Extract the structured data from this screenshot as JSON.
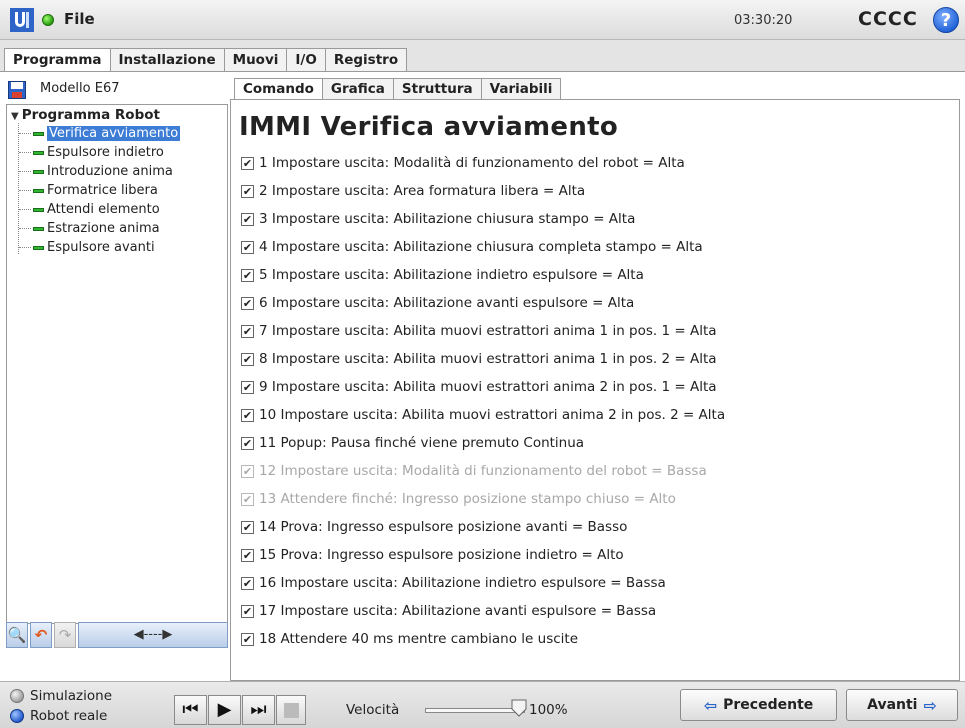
{
  "titlebar": {
    "file_label": "File",
    "clock": "03:30:20",
    "robot_name": "CCCC",
    "help_glyph": "?",
    "logo_icon": "ur-logo-icon",
    "status_icon": "green-status-dot-icon"
  },
  "main_tabs": [
    {
      "label": "Programma",
      "active": true
    },
    {
      "label": "Installazione",
      "active": false
    },
    {
      "label": "Muovi",
      "active": false
    },
    {
      "label": "I/O",
      "active": false
    },
    {
      "label": "Registro",
      "active": false
    }
  ],
  "program": {
    "model_name": "Modello E67"
  },
  "tree": {
    "root_label": "Programma Robot",
    "items": [
      {
        "label": "Verifica avviamento",
        "selected": true
      },
      {
        "label": "Espulsore indietro",
        "selected": false
      },
      {
        "label": "Introduzione anima",
        "selected": false
      },
      {
        "label": "Formatrice libera",
        "selected": false
      },
      {
        "label": "Attendi elemento",
        "selected": false
      },
      {
        "label": "Estrazione anima",
        "selected": false
      },
      {
        "label": "Espulsore avanti",
        "selected": false
      }
    ]
  },
  "tree_toolbar": {
    "search_glyph": "🔍",
    "undo_glyph": "↶",
    "redo_glyph": "↷",
    "move_glyph": "◀----▶"
  },
  "sub_tabs": [
    {
      "label": "Comando",
      "active": true
    },
    {
      "label": "Grafica",
      "active": false
    },
    {
      "label": "Struttura",
      "active": false
    },
    {
      "label": "Variabili",
      "active": false
    }
  ],
  "panel": {
    "title": "IMMI Verifica avviamento",
    "commands": [
      {
        "text": "1 Impostare uscita: Modalità di funzionamento del robot = Alta",
        "checked": true,
        "enabled": true
      },
      {
        "text": "2 Impostare uscita: Area formatura libera = Alta",
        "checked": true,
        "enabled": true
      },
      {
        "text": "3 Impostare uscita: Abilitazione chiusura stampo = Alta",
        "checked": true,
        "enabled": true
      },
      {
        "text": "4 Impostare uscita: Abilitazione chiusura completa stampo = Alta",
        "checked": true,
        "enabled": true
      },
      {
        "text": "5 Impostare uscita: Abilitazione indietro espulsore = Alta",
        "checked": true,
        "enabled": true
      },
      {
        "text": "6 Impostare uscita: Abilitazione avanti espulsore = Alta",
        "checked": true,
        "enabled": true
      },
      {
        "text": "7 Impostare uscita: Abilita muovi estrattori anima 1 in pos. 1 = Alta",
        "checked": true,
        "enabled": true
      },
      {
        "text": "8 Impostare uscita: Abilita muovi estrattori anima 1 in pos. 2 = Alta",
        "checked": true,
        "enabled": true
      },
      {
        "text": "9 Impostare uscita: Abilita muovi estrattori anima 2 in pos. 1 = Alta",
        "checked": true,
        "enabled": true
      },
      {
        "text": "10 Impostare uscita: Abilita muovi estrattori anima 2 in pos. 2 = Alta",
        "checked": true,
        "enabled": true
      },
      {
        "text": "11 Popup: Pausa finché viene premuto Continua",
        "checked": true,
        "enabled": true
      },
      {
        "text": "12 Impostare uscita: Modalità di funzionamento del robot = Bassa",
        "checked": true,
        "enabled": false
      },
      {
        "text": "13 Attendere finché: Ingresso posizione stampo chiuso = Alto",
        "checked": true,
        "enabled": false
      },
      {
        "text": "14 Prova: Ingresso espulsore posizione avanti = Basso",
        "checked": true,
        "enabled": true
      },
      {
        "text": "15 Prova: Ingresso espulsore posizione indietro = Alto",
        "checked": true,
        "enabled": true
      },
      {
        "text": "16 Impostare uscita: Abilitazione indietro espulsore = Bassa",
        "checked": true,
        "enabled": true
      },
      {
        "text": "17 Impostare uscita: Abilitazione avanti espulsore = Bassa",
        "checked": true,
        "enabled": true
      },
      {
        "text": "18 Attendere 40 ms mentre cambiano le uscite",
        "checked": true,
        "enabled": true
      }
    ]
  },
  "bottom": {
    "mode_simulation": "Simulazione",
    "mode_real": "Robot reale",
    "speed_label": "Velocità",
    "speed_value": "100%",
    "speed_fraction": 1.0,
    "prev_label": "Precedente",
    "next_label": "Avanti",
    "prev_glyph": "⇦",
    "next_glyph": "⇨"
  },
  "colors": {
    "selection": "#3d7dd6",
    "tree_bar": "#2fb52f",
    "disabled_text": "#a8a8a8",
    "nav_arrow": "#2a64c8"
  }
}
